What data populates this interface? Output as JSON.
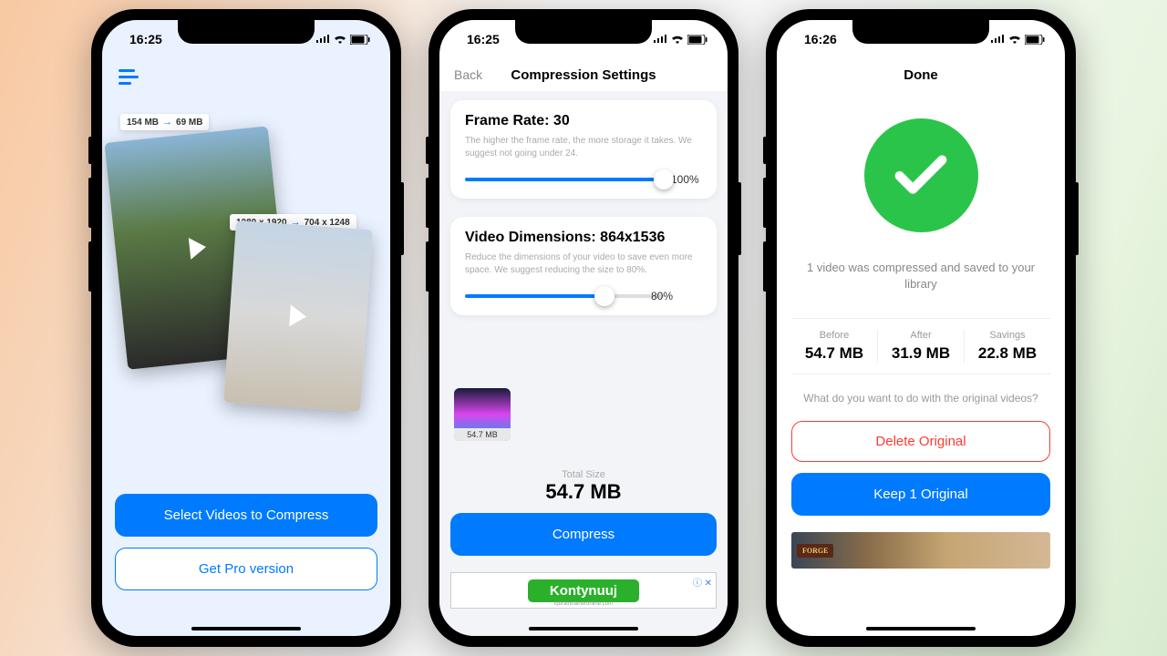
{
  "phone1": {
    "time": "16:25",
    "tag1_from": "154 MB",
    "tag1_to": "69 MB",
    "tag2_from": "1080 x 1920",
    "tag2_to": "704 x 1248",
    "select_btn": "Select Videos to Compress",
    "pro_btn": "Get Pro version"
  },
  "phone2": {
    "time": "16:25",
    "back": "Back",
    "title": "Compression Settings",
    "framerate": {
      "title": "Frame Rate: 30",
      "desc": "The higher the frame rate, the more storage it takes. We suggest not going under 24.",
      "value": "100%",
      "pct": 100
    },
    "dimensions": {
      "title": "Video Dimensions: 864x1536",
      "desc": "Reduce the dimensions of your video to save even more space. We suggest reducing the size to 80%.",
      "value": "80%",
      "pct": 80
    },
    "thumb_size": "54.7 MB",
    "total_label": "Total Size",
    "total_value": "54.7 MB",
    "compress_btn": "Compress",
    "ad_text": "Kontynuuj",
    "ad_sub": "iqbraintraineronline.com"
  },
  "phone3": {
    "time": "16:26",
    "title": "Done",
    "msg": "1 video was compressed and saved to your library",
    "before_label": "Before",
    "before_val": "54.7 MB",
    "after_label": "After",
    "after_val": "31.9 MB",
    "savings_label": "Savings",
    "savings_val": "22.8 MB",
    "question": "What do you want to do with the original videos?",
    "delete_btn": "Delete Original",
    "keep_btn": "Keep 1 Original",
    "ad_logo": "FORGE"
  }
}
